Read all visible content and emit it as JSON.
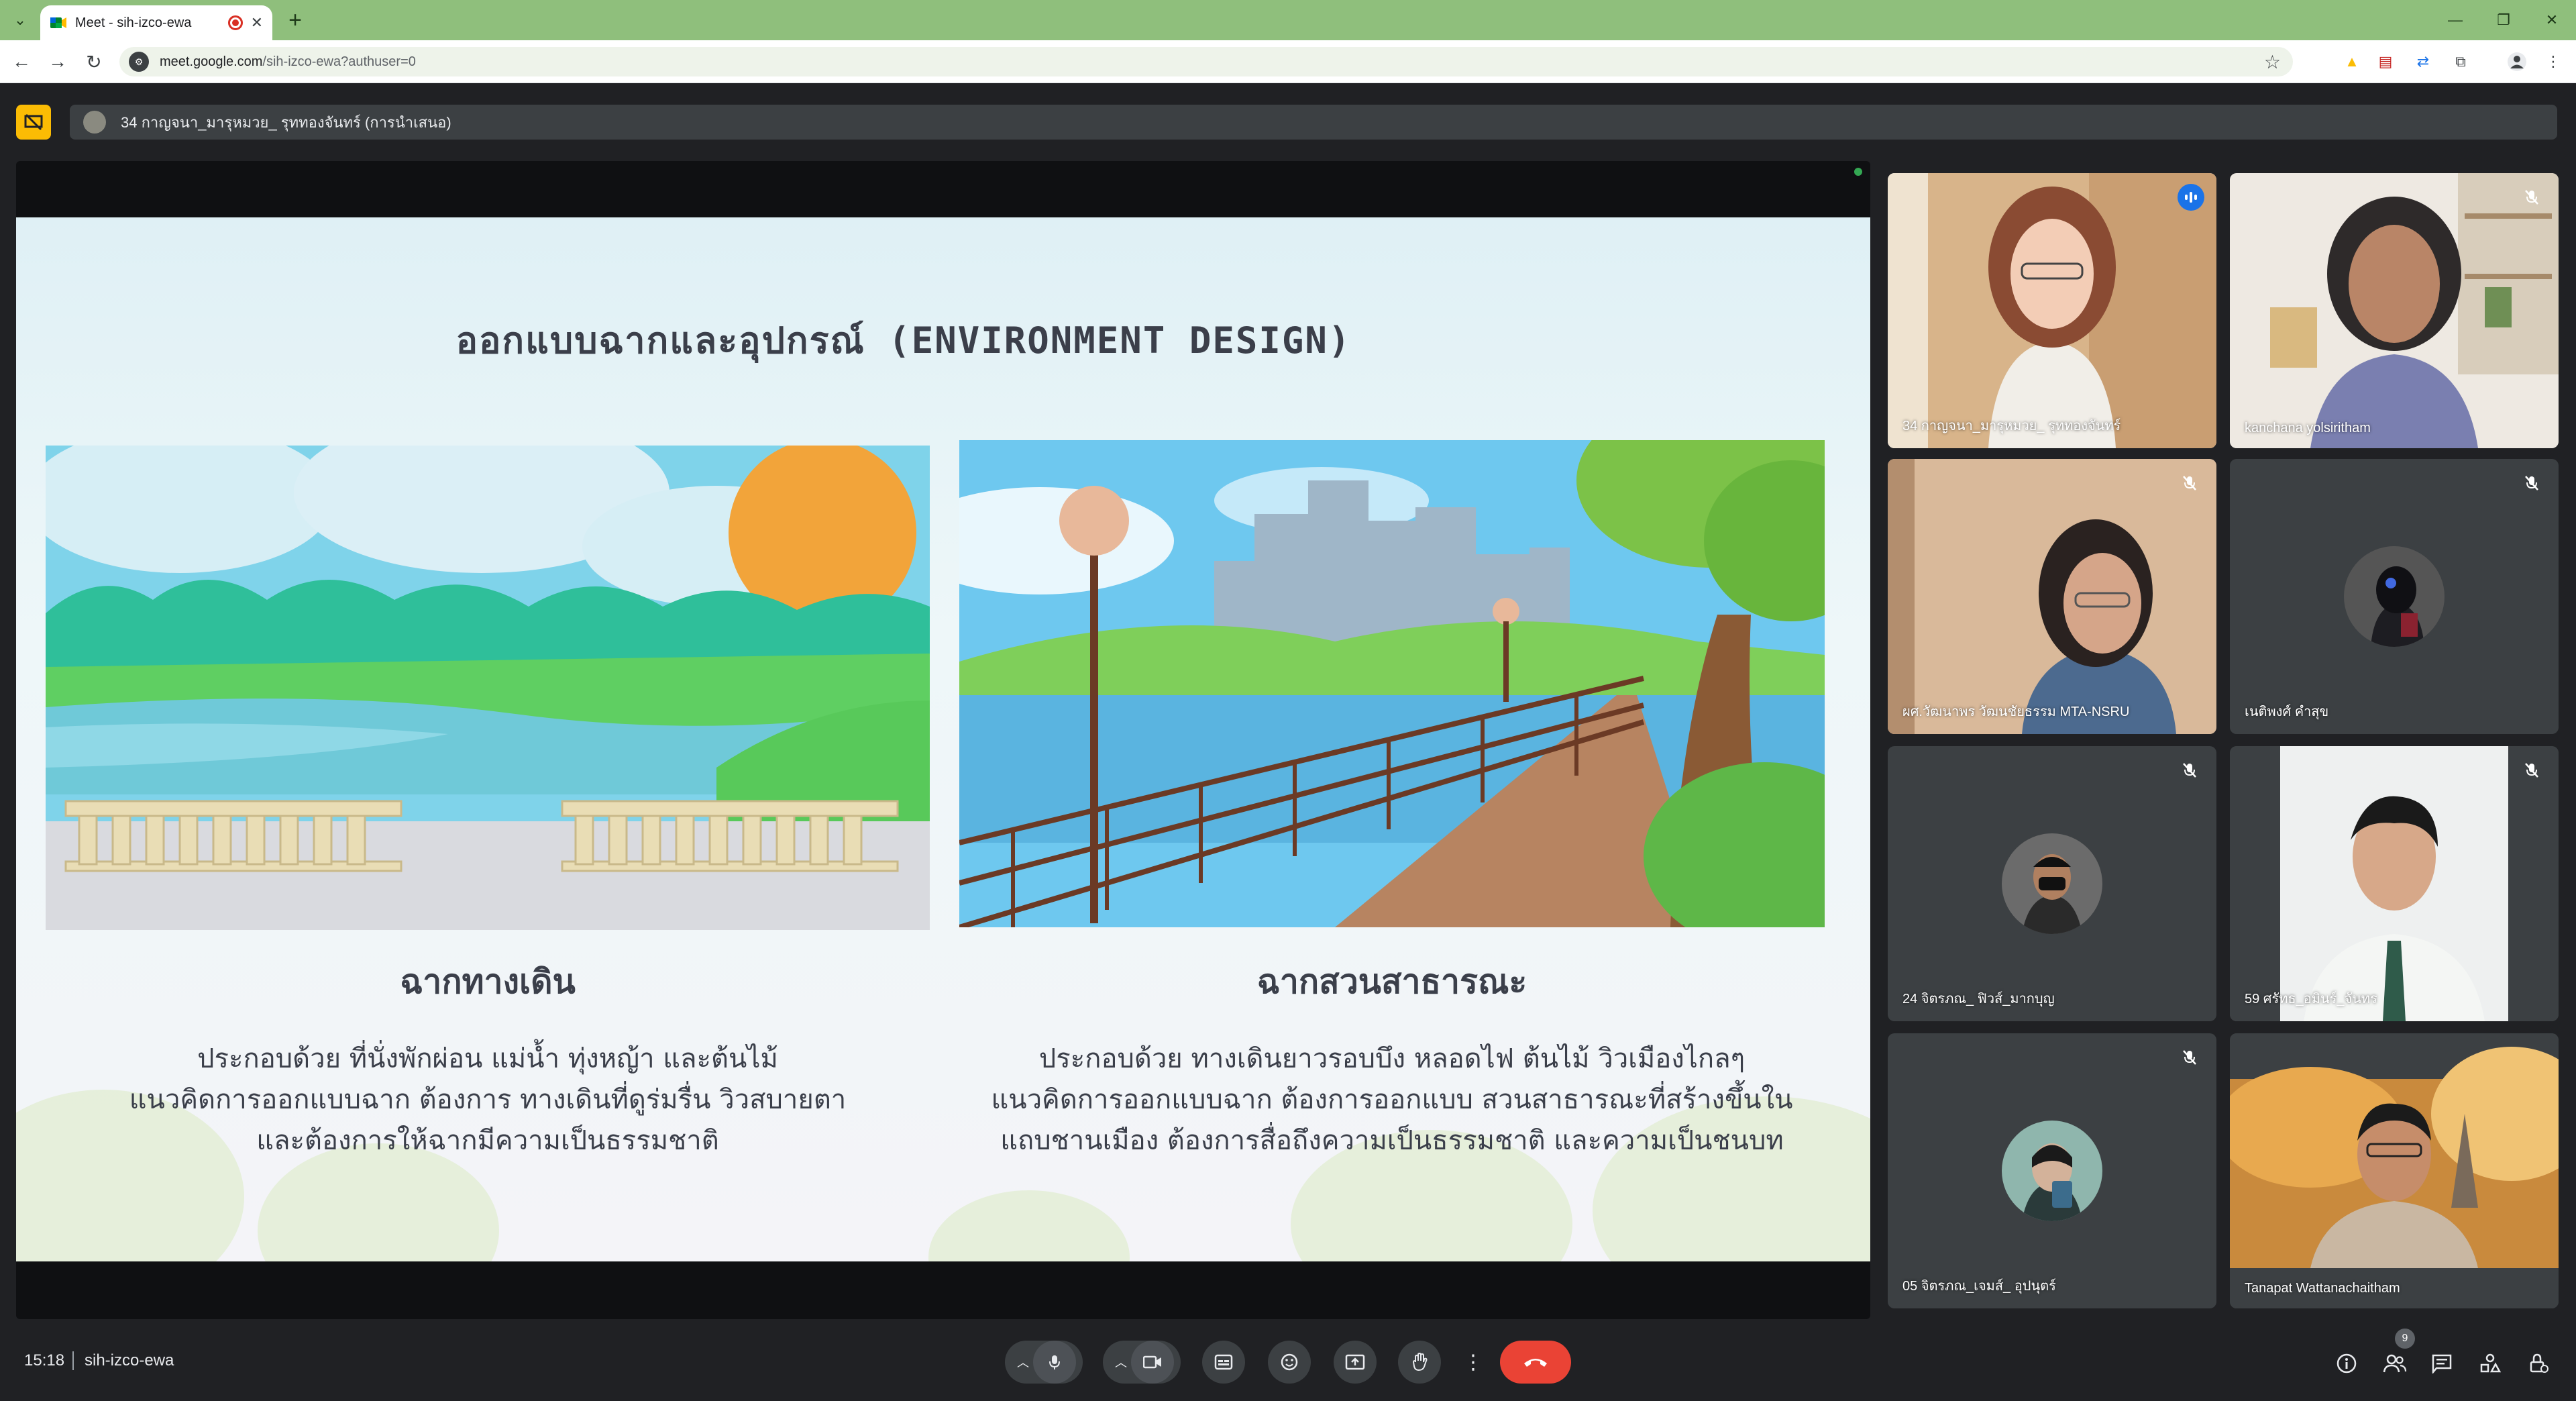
{
  "browser": {
    "tab_title": "Meet - sih-izco-ewa",
    "url_host": "meet.google.com",
    "url_path": "/sih-izco-ewa?authuser=0"
  },
  "meet": {
    "presenter_label": "34 กาญจนา_มารุหมวย_ รุททองจันทร์ (การนำเสนอ)",
    "clock": "15:18",
    "meeting_code": "sih-izco-ewa",
    "participant_count": "9"
  },
  "slide": {
    "title": "ออกแบบฉากและอุปกรณ์ (ENVIRONMENT DESIGN)",
    "left": {
      "heading": "ฉากทางเดิน",
      "lines": [
        "ประกอบด้วย ที่นั่งพักผ่อน แม่น้ำ ทุ่งหญ้า และต้นไม้",
        "แนวคิดการออกแบบฉาก ต้องการ ทางเดินที่ดูร่มรื่น วิวสบายตา",
        "และต้องการให้ฉากมีความเป็นธรรมชาติ"
      ]
    },
    "right": {
      "heading": "ฉากสวนสาธารณะ",
      "lines": [
        "ประกอบด้วย ทางเดินยาวรอบบึง หลอดไฟ ต้นไม้ วิวเมืองไกลๆ",
        "แนวคิดการออกแบบฉาก ต้องการออกแบบ สวนสาธารณะที่สร้างขึ้นใน",
        "แถบชานเมือง ต้องการสื่อถึงความเป็นธรรมชาติ และความเป็นชนบท"
      ]
    }
  },
  "participants": [
    {
      "name": "34 กาญจนา_มารุหมวย_ รุททองจันทร์",
      "state": "speaking"
    },
    {
      "name": "kanchana yolsiritham",
      "state": "muted"
    },
    {
      "name": "ผศ.วัฒนาพร วัฒนชัยธรรม MTA-NSRU",
      "state": "muted"
    },
    {
      "name": "เนติพงศ์ คำสุข",
      "state": "muted"
    },
    {
      "name": "24 จิตรภณ_ ฟิวส์_มากบุญ",
      "state": "muted"
    },
    {
      "name": "59 ศรัทธ_อมินร์_จันทร",
      "state": "muted"
    },
    {
      "name": "05 จิตรภณ_เจมส์_ อุปนุตร์",
      "state": "muted"
    },
    {
      "name": "Tanapat Wattanachaitham",
      "state": "video"
    }
  ],
  "colors": {
    "meet_bg": "#202124",
    "tile_bg": "#3c4043",
    "end_call": "#ea4335",
    "present_badge": "#fbbc04",
    "tab_bar": "#8fbf7c",
    "speaking_outline": "#8ab4f8"
  },
  "icons": {
    "controls": [
      "chevron-up-icon",
      "mic-icon",
      "chevron-up-icon",
      "camera-icon",
      "captions-icon",
      "emoji-icon",
      "present-icon",
      "raise-hand-icon",
      "more-icon",
      "end-call-icon"
    ],
    "right_panel": [
      "info-icon",
      "people-icon",
      "chat-icon",
      "activities-icon",
      "host-controls-icon"
    ]
  }
}
